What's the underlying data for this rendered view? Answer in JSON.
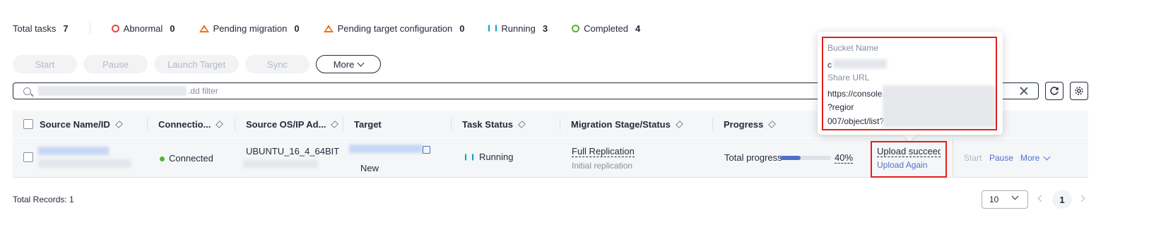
{
  "summary": {
    "total_label": "Total tasks",
    "total_count": "7",
    "statuses": [
      {
        "label": "Abnormal",
        "count": "0",
        "icon": "abnormal-icon",
        "color": "#e54545"
      },
      {
        "label": "Pending migration",
        "count": "0",
        "icon": "warning-triangle-icon",
        "color": "#f66f0f"
      },
      {
        "label": "Pending target configuration",
        "count": "0",
        "icon": "warning-triangle-icon",
        "color": "#f66f0f"
      },
      {
        "label": "Running",
        "count": "3",
        "icon": "running-sync-icon",
        "color": "#0aa1c4"
      },
      {
        "label": "Completed",
        "count": "4",
        "icon": "completed-circle-icon",
        "color": "#50b432"
      }
    ]
  },
  "toolbar": {
    "start": "Start",
    "pause": "Pause",
    "launch_target": "Launch Target",
    "sync": "Sync",
    "more": "More"
  },
  "search": {
    "placeholder_tail": ".dd filter"
  },
  "table": {
    "headers": [
      "Source Name/ID",
      "Connectio...",
      "Source OS/IP Ad...",
      "Target",
      "Task Status",
      "Migration Stage/Status",
      "Progress"
    ],
    "row": {
      "connection": "Connected",
      "source_os": "UBUNTU_16_4_64BIT",
      "target_status": "New",
      "task_status": "Running",
      "stage": "Full Replication",
      "stage_sub": "Initial replication",
      "progress_label": "Total progress",
      "progress_value": "40%",
      "progress_fraction": 0.4,
      "upload_status": "Upload succeedec",
      "upload_again": "Upload Again",
      "actions": {
        "start": "Start",
        "pause": "Pause",
        "more": "More"
      }
    }
  },
  "popup": {
    "bucket_label": "Bucket Name",
    "bucket_value": "c",
    "share_label": "Share URL",
    "url_line1": "https://console.",
    "url_line2": "?regior",
    "url_line3": "007/object/list?"
  },
  "footer": {
    "total_records": "Total Records: 1",
    "page_size": "10",
    "current_page": "1"
  }
}
